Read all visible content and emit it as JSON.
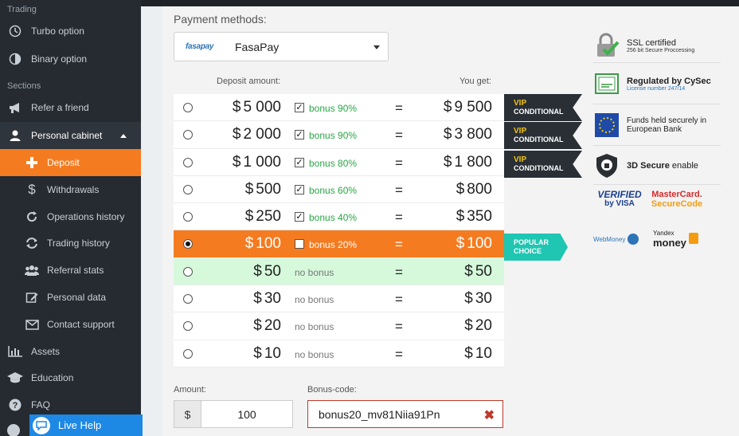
{
  "sidebar": {
    "section_trading": "Trading",
    "turbo": "Turbo option",
    "binary": "Binary option",
    "section_sections": "Sections",
    "refer": "Refer a friend",
    "cabinet": "Personal cabinet",
    "deposit": "Deposit",
    "withdrawals": "Withdrawals",
    "operations": "Operations history",
    "trading_history": "Trading history",
    "referral": "Referral stats",
    "personal_data": "Personal data",
    "contact": "Contact support",
    "assets": "Assets",
    "education": "Education",
    "faq": "FAQ",
    "live_help": "Live Help"
  },
  "payment": {
    "label": "Payment methods:",
    "logo_a": "fasa",
    "logo_b": "pay",
    "selected": "FasaPay"
  },
  "table": {
    "hdr_deposit": "Deposit amount:",
    "hdr_get": "You get:",
    "currency": "$",
    "eq": "=",
    "check": "✓",
    "rows": [
      {
        "amount": "5 000",
        "bonus": "bonus 90%",
        "get": "9 500"
      },
      {
        "amount": "2 000",
        "bonus": "bonus 90%",
        "get": "3 800"
      },
      {
        "amount": "1 000",
        "bonus": "bonus 80%",
        "get": "1 800"
      },
      {
        "amount": "500",
        "bonus": "bonus 60%",
        "get": "800"
      },
      {
        "amount": "250",
        "bonus": "bonus 40%",
        "get": "350"
      },
      {
        "amount": "100",
        "bonus": "bonus 20%",
        "get": "100"
      },
      {
        "amount": "50",
        "bonus": "no bonus",
        "get": "50"
      },
      {
        "amount": "30",
        "bonus": "no bonus",
        "get": "30"
      },
      {
        "amount": "20",
        "bonus": "no bonus",
        "get": "20"
      },
      {
        "amount": "10",
        "bonus": "no bonus",
        "get": "10"
      }
    ]
  },
  "tags": {
    "vip_l1": "VIP",
    "vip_l2": "CONDITIONAL",
    "pop_l1": "POPULAR",
    "pop_l2": "CHOICE"
  },
  "form": {
    "amount_label": "Amount:",
    "amount_currency": "$",
    "amount_value": "100",
    "bonus_label": "Bonus-code:",
    "bonus_value": "bonus20_mv81Niia91Pn"
  },
  "trust": {
    "ssl_title": "SSL certified",
    "ssl_sub": "256 bit Secure Proccessing",
    "cysec_title": "Regulated by CySec",
    "cysec_sub": "License number 247/14",
    "eu_title_1": "Funds held securely in",
    "eu_title_2": "European Bank",
    "secure_bold": "3D Secure",
    "secure_rest": " enable",
    "visa_1": "VERIFIED",
    "visa_2": "by VISA",
    "mc_1": "MasterCard.",
    "mc_2": "SecureCode",
    "webmoney": "WebMoney",
    "yandex_1": "Yandex",
    "yandex_2": "money"
  },
  "colors": {
    "accent": "#f47b20",
    "sidebar": "#262b31",
    "popular": "#1fc6b2",
    "green": "#28a745"
  }
}
